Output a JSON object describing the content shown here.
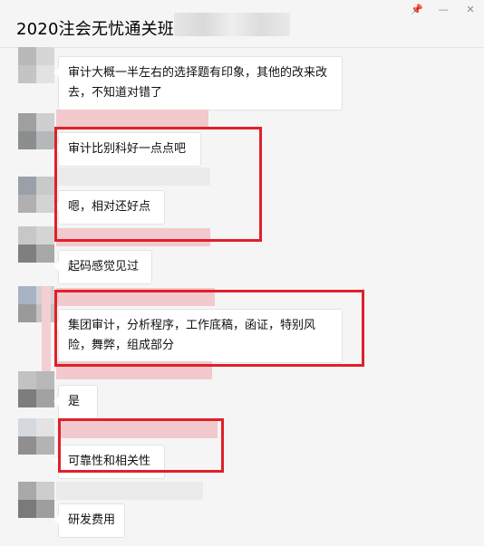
{
  "window": {
    "title": "2020注会无忧通关班",
    "controls": {
      "pin_icon": "📌",
      "minimize_icon": "—",
      "close_icon": "✕"
    }
  },
  "messages": [
    {
      "text": "审计大概一半左右的选择题有印象，其他的改来改去，不知道对错了"
    },
    {
      "text": "审计比别科好一点点吧"
    },
    {
      "text": "嗯，相对还好点"
    },
    {
      "text": "起码感觉见过"
    },
    {
      "text": "集团审计，分析程序，工作底稿，函证，特别风险，舞弊，组成部分"
    },
    {
      "text": "是"
    },
    {
      "text": "可靠性和相关性"
    },
    {
      "text": "研发费用"
    }
  ],
  "colors": {
    "highlight": "#e0202a",
    "blur_pink": "#f2c9cc",
    "bubble_bg": "#ffffff"
  }
}
